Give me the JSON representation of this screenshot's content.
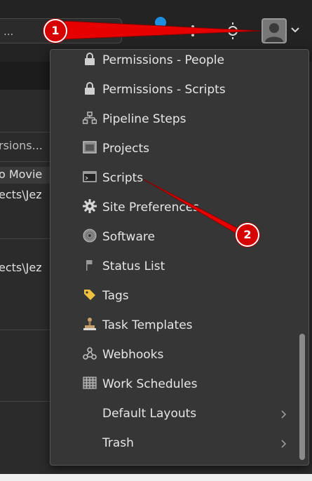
{
  "topbar": {
    "search_value": "..."
  },
  "background": {
    "versions_text": "rsions...",
    "column_header": "o Movie",
    "path_1": "ects\\Jez",
    "path_2": "ects\\Jez"
  },
  "menu": {
    "items": [
      {
        "label": "Permissions - People",
        "icon": "lock-icon"
      },
      {
        "label": "Permissions - Scripts",
        "icon": "lock-icon"
      },
      {
        "label": "Pipeline Steps",
        "icon": "pipeline-icon"
      },
      {
        "label": "Projects",
        "icon": "projects-icon"
      },
      {
        "label": "Scripts",
        "icon": "scripts-icon"
      },
      {
        "label": "Site Preferences",
        "icon": "gear-icon"
      },
      {
        "label": "Software",
        "icon": "software-disc-icon"
      },
      {
        "label": "Status List",
        "icon": "flag-icon"
      },
      {
        "label": "Tags",
        "icon": "tag-icon"
      },
      {
        "label": "Task Templates",
        "icon": "stamp-icon"
      },
      {
        "label": "Webhooks",
        "icon": "webhook-icon"
      },
      {
        "label": "Work Schedules",
        "icon": "calendar-grid-icon"
      },
      {
        "label": "Default Layouts",
        "icon": "",
        "submenu": true
      },
      {
        "label": "Trash",
        "icon": "",
        "submenu": true
      }
    ]
  },
  "annotations": {
    "badge_1": "1",
    "badge_2": "2",
    "color": "#e00000"
  }
}
